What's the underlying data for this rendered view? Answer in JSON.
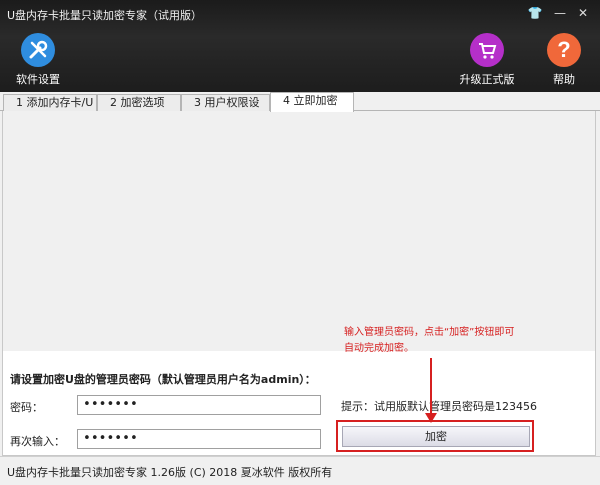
{
  "window": {
    "title": "U盘内存卡批量只读加密专家（试用版）",
    "controls": {
      "skin": "👕",
      "minimize": "—",
      "close": "✕"
    }
  },
  "toolbar": {
    "settings_label": "软件设置",
    "upgrade_label": "升级正式版",
    "help_label": "帮助",
    "settings_icon": "tools-icon",
    "upgrade_icon": "cart-icon",
    "help_icon": "question-icon",
    "colors": {
      "settings": "#2f8ddf",
      "upgrade": "#b52fc9",
      "help": "#f0683a"
    }
  },
  "tabs": [
    {
      "label": "1 添加内存卡/U盘"
    },
    {
      "label": "2 加密选项"
    },
    {
      "label": "3 用户权限设置"
    },
    {
      "label": "4 立即加密"
    }
  ],
  "form": {
    "title": "请设置加密U盘的管理员密码（默认管理员用户名为admin）：",
    "password_label": "密码：",
    "password_value": "•••••••",
    "confirm_label": "再次输入：",
    "confirm_value": "•••••••",
    "hint": "提示：试用版默认管理员密码是123456",
    "encrypt_label": "加密"
  },
  "annotation": {
    "line1": "输入管理员密码，点击“加密”按钮即可",
    "line2": "自动完成加密。",
    "color": "#d62020"
  },
  "statusbar": {
    "text": "U盘内存卡批量只读加密专家  1.26版  (C) 2018 夏冰软件 版权所有"
  }
}
